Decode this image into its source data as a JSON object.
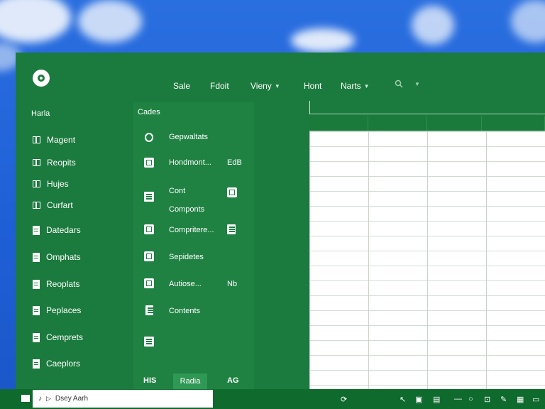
{
  "ribbon": {
    "tabs": [
      "Sale",
      "Fdoit",
      "Vieny",
      "Hont",
      "Narts"
    ]
  },
  "left_pane": {
    "heading": "Harla",
    "items": [
      "Magent",
      "Reopits",
      "Hujes",
      "Curfart",
      "Datedars",
      "Omphats",
      "Reoplats",
      "Peplaces",
      "Cemprets",
      "Caeplors"
    ]
  },
  "mid_pane": {
    "heading": "Cades",
    "items": [
      {
        "label": "Gepwaltats",
        "right": ""
      },
      {
        "label": "Hondmont...",
        "right": "EdB"
      },
      {
        "label": "Cont\nComponts",
        "right": ""
      },
      {
        "label": "Compritere...",
        "right": ""
      },
      {
        "label": "Sepidetes",
        "right": ""
      },
      {
        "label": "Autiose...",
        "right": "Nb"
      },
      {
        "label": "Contents",
        "right": ""
      },
      {
        "label": "",
        "right": ""
      }
    ],
    "bottom": {
      "left": "HIS",
      "button": "Radia",
      "right": "AG"
    }
  },
  "taskbar": {
    "search_text": "Dsey Aarh"
  }
}
